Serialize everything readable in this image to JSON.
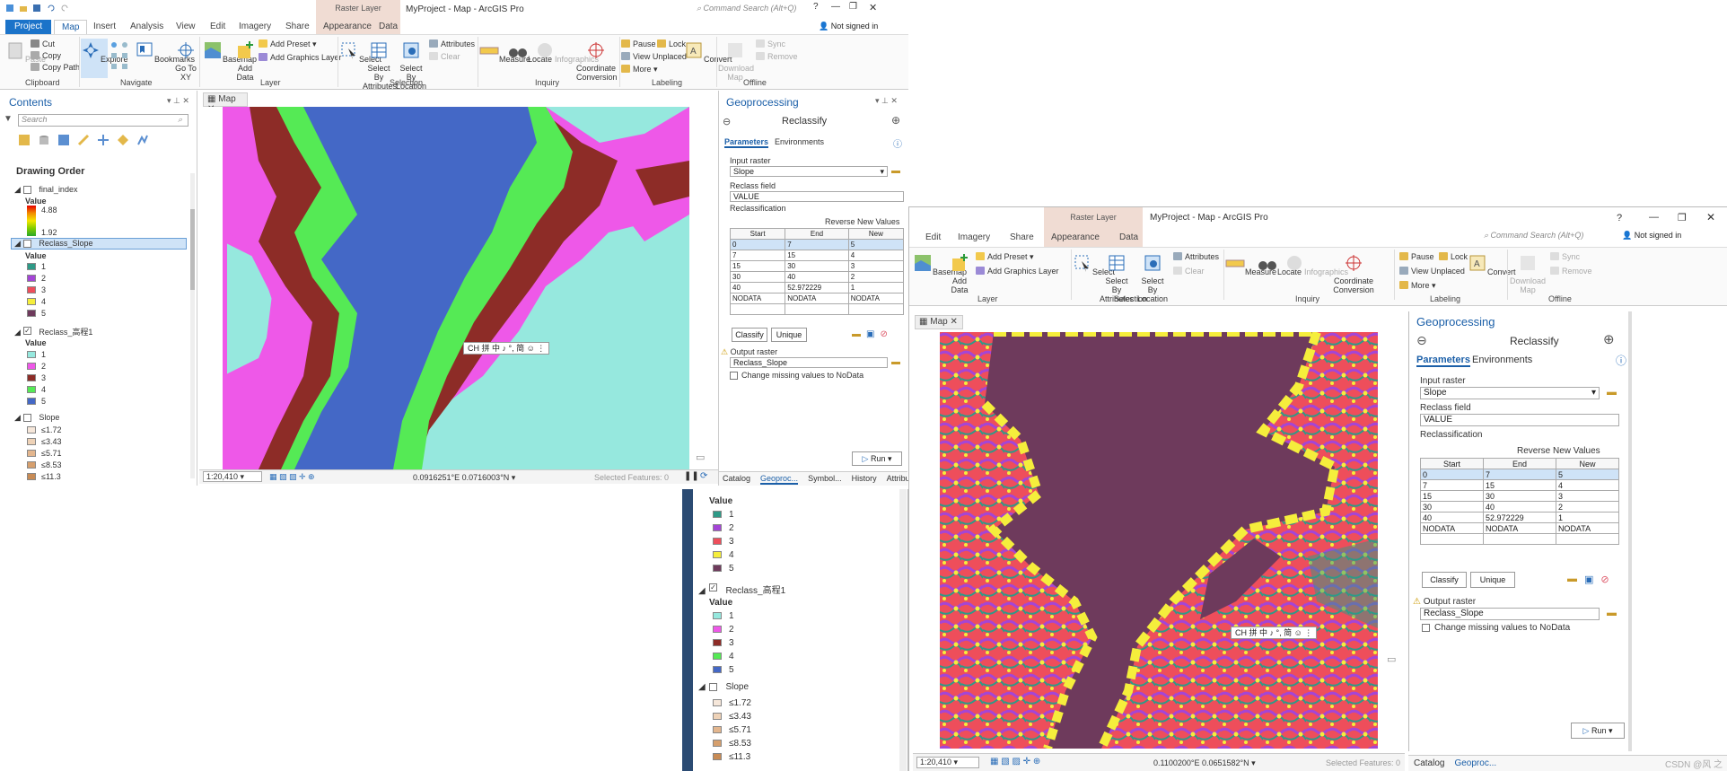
{
  "w1": {
    "title": "MyProject - Map - ArcGIS Pro",
    "context_tab": "Raster Layer",
    "search_placeholder": "Command Search (Alt+Q)",
    "signed": "Not signed in",
    "tabs": [
      "Project",
      "Map",
      "Insert",
      "Analysis",
      "View",
      "Edit",
      "Imagery",
      "Share",
      "Appearance",
      "Data"
    ],
    "ribbon": {
      "paste": "Paste",
      "cut": "Cut",
      "copy": "Copy",
      "copy_path": "Copy Path",
      "clipboard": "Clipboard",
      "explore": "Explore",
      "bookmarks": "Bookmarks",
      "goto": "Go To XY",
      "navigate": "Navigate",
      "basemap": "Basemap",
      "add_data": "Add Data",
      "add_preset": "Add Preset",
      "add_graphics": "Add Graphics Layer",
      "layer": "Layer",
      "select": "Select",
      "sel_attr": "Select By Attributes",
      "sel_loc": "Select By Location",
      "attributes": "Attributes",
      "clear": "Clear",
      "selection": "Selection",
      "measure": "Measure",
      "locate": "Locate",
      "infographics": "Infographics",
      "coord": "Coordinate Conversion",
      "inquiry": "Inquiry",
      "pause": "Pause",
      "lock": "Lock",
      "view_unplaced": "View Unplaced",
      "more": "More",
      "convert": "Convert",
      "labeling": "Labeling",
      "download": "Download Map",
      "sync": "Sync",
      "remove": "Remove",
      "offline": "Offline"
    },
    "contents": {
      "title": "Contents",
      "search": "Search",
      "drawing_order": "Drawing Order",
      "final_index": "final_index",
      "value": "Value",
      "hi": "4.88",
      "lo": "1.92",
      "reclass_slope": "Reclass_Slope",
      "reclass_elev": "Reclass_高程1",
      "slope": "Slope",
      "classes": [
        "1",
        "2",
        "3",
        "4",
        "5"
      ],
      "slope_breaks": [
        "≤1.72",
        "≤3.43",
        "≤5.71",
        "≤8.53",
        "≤11.3"
      ]
    },
    "map_tab": "Map",
    "scale": "1:20,410",
    "coords": "0.0916251°E 0.0716003°N",
    "selected": "Selected Features: 0",
    "gp": {
      "title": "Geoprocessing",
      "tool": "Reclassify",
      "params": "Parameters",
      "envs": "Environments",
      "input_raster_label": "Input raster",
      "input_raster": "Slope",
      "reclass_field_label": "Reclass field",
      "reclass_field": "VALUE",
      "reclassification": "Reclassification",
      "reverse": "Reverse New Values",
      "cols": [
        "Start",
        "End",
        "New"
      ],
      "rows": [
        [
          "0",
          "7",
          "5"
        ],
        [
          "7",
          "15",
          "4"
        ],
        [
          "15",
          "30",
          "3"
        ],
        [
          "30",
          "40",
          "2"
        ],
        [
          "40",
          "52.972229",
          "1"
        ],
        [
          "NODATA",
          "NODATA",
          "NODATA"
        ]
      ],
      "classify": "Classify",
      "unique": "Unique",
      "output_label": "Output raster",
      "output": "Reclass_Slope",
      "nodata_opt": "Change missing values to NoData",
      "run": "Run"
    },
    "bottom_tabs": [
      "Catalog",
      "Geoproc...",
      "Symbol...",
      "History",
      "Attribu..."
    ],
    "ime": "CH 拼 中 ♪ °, 简 ☺ ⋮"
  },
  "w2": {
    "title": "MyProject - Map - ArcGIS Pro",
    "context_tab": "Raster Layer",
    "search_placeholder": "Command Search (Alt+Q)",
    "signed": "Not signed in",
    "tabs": [
      "Edit",
      "Imagery",
      "Share",
      "Appearance",
      "Data"
    ],
    "map_tab": "Map",
    "scale": "1:20,410",
    "coords": "0.1100200°E 0.0651582°N",
    "selected": "Selected Features: 0",
    "bottom_tabs": [
      "Catalog",
      "Geoproc..."
    ],
    "watermark": "CSDN @风 之 芯"
  },
  "colors": {
    "class1": "#2e9a87",
    "class2": "#a445d6",
    "class3": "#ee4e5b",
    "class4": "#f5ee3c",
    "class5": "#6e3a5c",
    "elev1": "#96e8de",
    "elev2": "#ee58e8",
    "elev3": "#8d2c27",
    "elev4": "#55ea55",
    "elev5": "#4468c6",
    "slope1": "#f6e7da",
    "slope2": "#eed2b7",
    "slope3": "#e3b68e",
    "slope4": "#d69f6d",
    "slope5": "#c88b55",
    "accent": "#1b73c9"
  }
}
